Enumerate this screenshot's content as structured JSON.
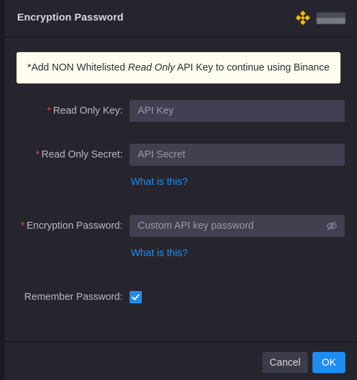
{
  "window": {
    "title": "Encryption Password",
    "brand": {
      "logo_icon": "binance-logo-icon",
      "wordmark_redacted": ""
    }
  },
  "banner": {
    "prefix": "*Add NON Whitelisted ",
    "emphasis": "Read Only",
    "suffix": " API Key to continue using Binance"
  },
  "form": {
    "fields": [
      {
        "required_marker": "*",
        "label": "Read Only Key",
        "colon": ":",
        "placeholder": "API Key",
        "value": ""
      },
      {
        "required_marker": "*",
        "label": "Read Only Secret",
        "colon": ":",
        "placeholder": "API Secret",
        "value": ""
      },
      {
        "required_marker": "*",
        "label": "Encryption Password",
        "colon": ":",
        "placeholder": "Custom API key password",
        "value": "",
        "reveal_icon": "eye-slash-icon"
      }
    ],
    "help_link_secret": "What is this?",
    "help_link_password": "What is this?",
    "remember": {
      "label": "Remember Password",
      "colon": ":",
      "checked": true,
      "check_icon": "checkmark-icon"
    }
  },
  "footer": {
    "cancel_label": "Cancel",
    "ok_label": "OK"
  },
  "colors": {
    "dialog_bg": "#26252e",
    "titlebar_bg": "#26252e",
    "input_bg": "#413f50",
    "banner_bg": "#fffdf0",
    "accent_blue": "#1f8cf0",
    "required_red": "#e8414b",
    "brand_yellow": "#f0b90b",
    "cancel_bg": "#3c3b49"
  }
}
